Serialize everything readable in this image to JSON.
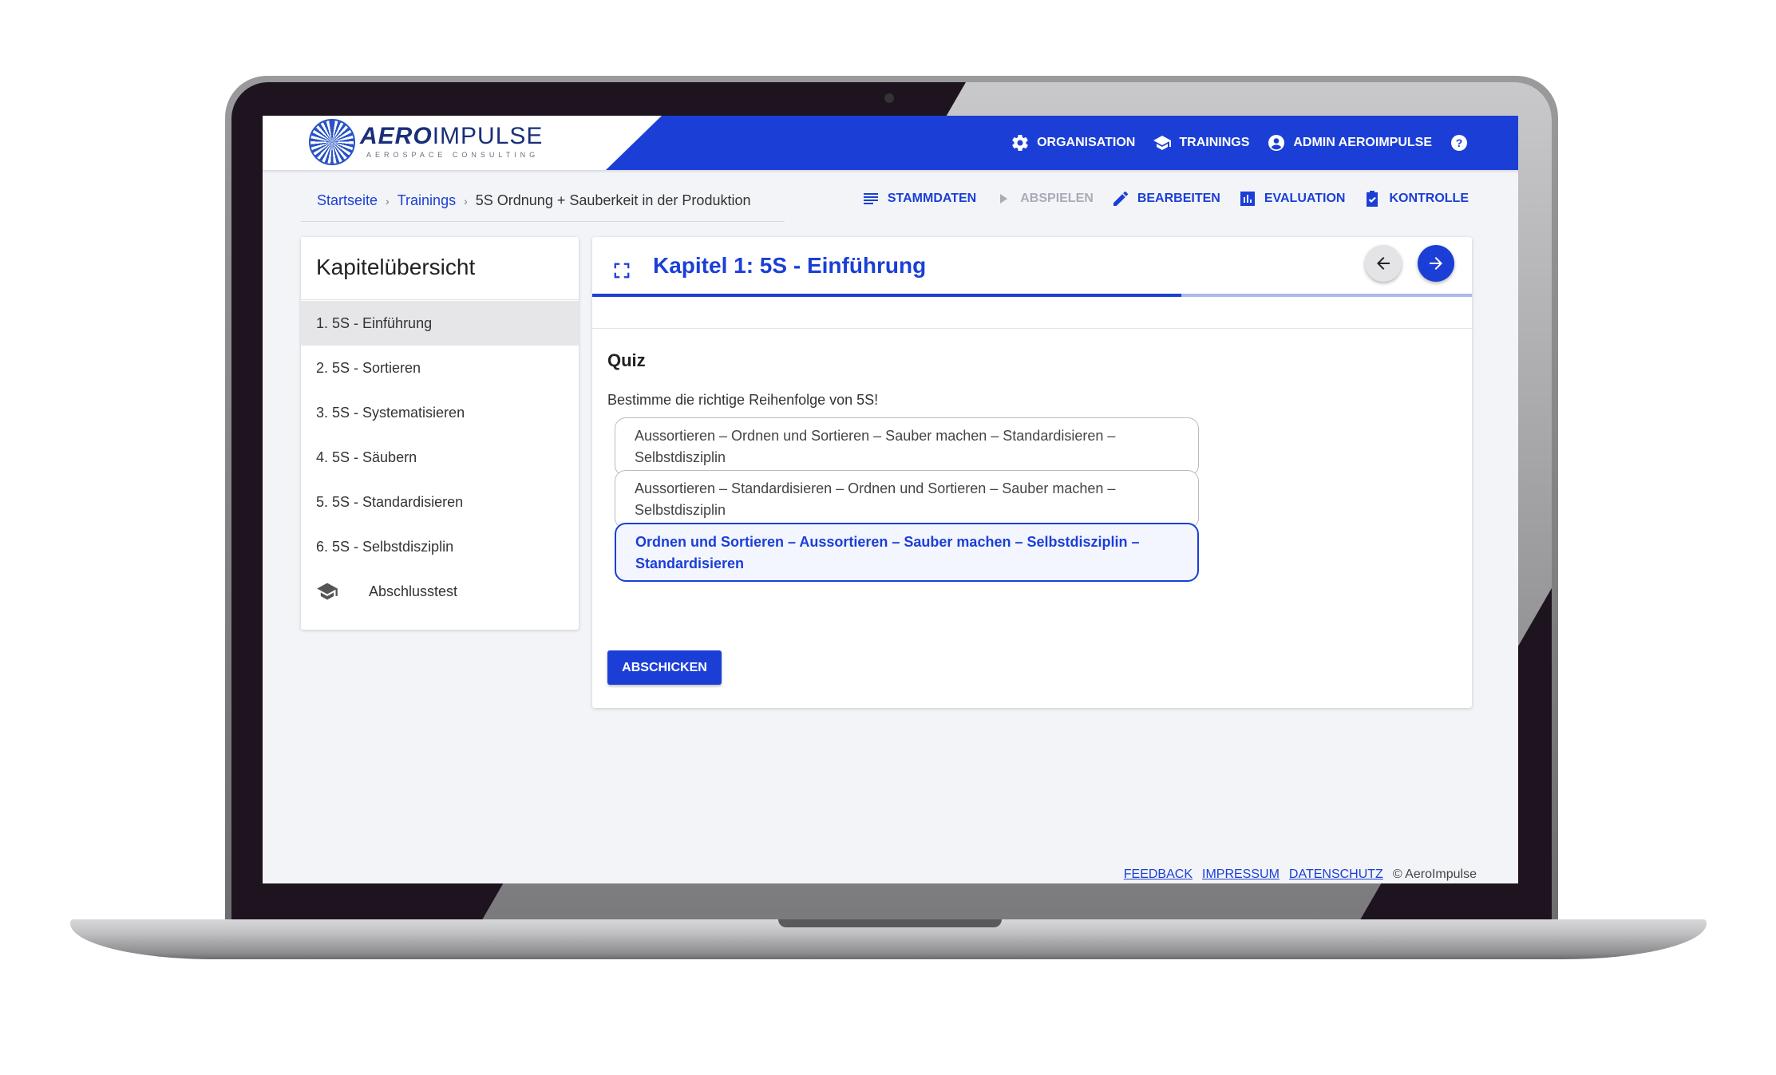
{
  "brand": {
    "name_bold": "AERO",
    "name_light": "IMPULSE",
    "tagline": "AEROSPACE CONSULTING",
    "accent_color": "#1b3fd6"
  },
  "topnav": {
    "items": [
      {
        "label": "ORGANISATION",
        "icon": "gear-icon"
      },
      {
        "label": "TRAININGS",
        "icon": "graduation-cap-icon"
      },
      {
        "label": "ADMIN AEROIMPULSE",
        "icon": "account-icon"
      }
    ],
    "help_icon": "help-icon"
  },
  "breadcrumb": {
    "items": [
      "Startseite",
      "Trainings"
    ],
    "current": "5S Ordnung + Sauberkeit in der Produktion",
    "separator": "›"
  },
  "actions": [
    {
      "label": "STAMMDATEN",
      "icon": "list-icon",
      "disabled": false
    },
    {
      "label": "ABSPIELEN",
      "icon": "play-icon",
      "disabled": true
    },
    {
      "label": "BEARBEITEN",
      "icon": "pencil-icon",
      "disabled": false
    },
    {
      "label": "EVALUATION",
      "icon": "bar-chart-icon",
      "disabled": false
    },
    {
      "label": "KONTROLLE",
      "icon": "checklist-icon",
      "disabled": false
    }
  ],
  "sidebar": {
    "title": "Kapitelübersicht",
    "chapters": [
      "1. 5S - Einführung",
      "2. 5S - Sortieren",
      "3. 5S - Systematisieren",
      "4. 5S - Säubern",
      "5. 5S - Standardisieren",
      "6. 5S - Selbstdisziplin"
    ],
    "active_index": 0,
    "final_test": "Abschlusstest"
  },
  "chapter": {
    "title": "Kapitel 1: 5S - Einführung",
    "progress": 0.67
  },
  "quiz": {
    "heading": "Quiz",
    "question": "Bestimme die richtige Reihenfolge von 5S!",
    "options": [
      {
        "line1": "Aussortieren – Ordnen und Sortieren – Sauber machen – Standardisieren –",
        "line2": "Selbstdisziplin"
      },
      {
        "line1": "Aussortieren – Standardisieren – Ordnen und Sortieren – Sauber machen –",
        "line2": "Selbstdisziplin"
      },
      {
        "line1": "Ordnen und Sortieren – Aussortieren – Sauber machen – Selbstdisziplin –",
        "line2": "Standardisieren"
      }
    ],
    "selected_index": 2,
    "submit_label": "ABSCHICKEN"
  },
  "footer": {
    "links": [
      "FEEDBACK",
      "IMPRESSUM",
      "DATENSCHUTZ"
    ],
    "copyright": "© AeroImpulse"
  }
}
